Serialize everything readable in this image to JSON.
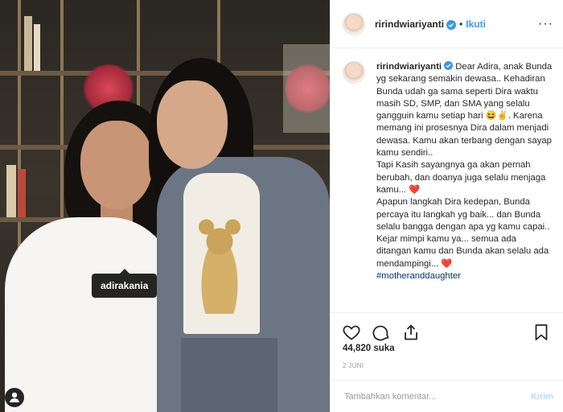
{
  "photo": {
    "tag_label": "adirakania"
  },
  "header": {
    "username": "ririndwiariyanti",
    "separator": "•",
    "follow_label": "Ikuti",
    "more_label": "···"
  },
  "caption": {
    "username": "ririndwiariyanti",
    "text": "Dear Adira, anak Bunda yg sekarang semakin dewasa.. Kehadiran Bunda udah ga sama seperti Dira waktu masih SD, SMP, dan SMA yang selalu gangguin kamu setiap hari 😆✌️. Karena memang ini prosesnya Dira dalam menjadi dewasa. Kamu akan terbang dengan sayap kamu sendiri..\nTapi Kasih sayangnya ga akan pernah berubah, dan doanya juga selalu menjaga kamu... ❤️\nApapun langkah Dira kedepan, Bunda percaya itu langkah yg baik... dan Bunda selalu bangga dengan apa yg kamu capai..\nKejar mimpi kamu ya... semua ada ditangan kamu dan Bunda akan selalu ada mendampingi... ❤️",
    "hashtag": "#motheranddaughter"
  },
  "stats": {
    "likes": "44,820 suka",
    "date": "2 JUNI"
  },
  "composer": {
    "placeholder": "Tambahkan komentar...",
    "post_label": "Kirim"
  },
  "colors": {
    "accent": "#3897f0",
    "post_disabled": "#b2dffc",
    "text": "#262626",
    "muted": "#999999"
  },
  "icons": [
    "verified-badge-icon",
    "more-icon",
    "heart-icon",
    "comment-icon",
    "share-icon",
    "bookmark-icon",
    "user-tag-icon"
  ]
}
